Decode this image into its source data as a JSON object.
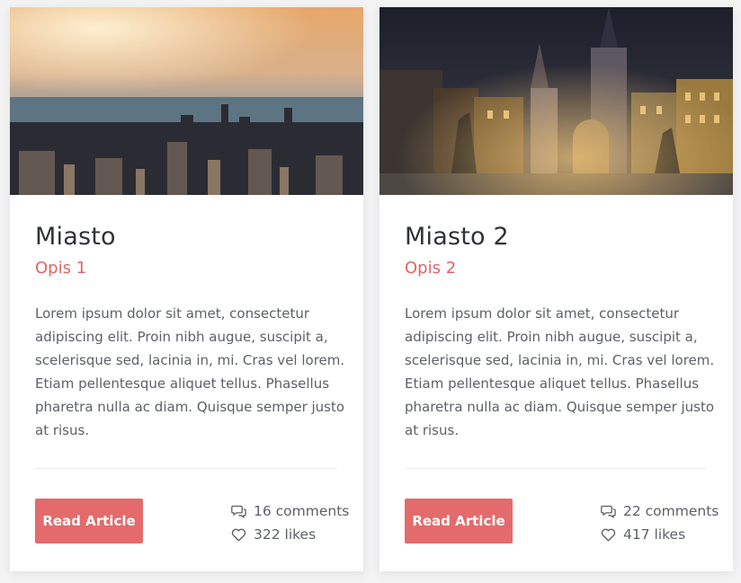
{
  "cards": [
    {
      "image_alt": "City skyline at sunset",
      "title": "Miasto",
      "subtitle": "Opis 1",
      "body": "Lorem ipsum dolor sit amet, consectetur adipiscing elit. Proin nibh augue, suscipit a, scelerisque sed, lacinia in, mi. Cras vel lorem. Etiam pellentesque aliquet tellus. Phasellus pharetra nulla ac diam. Quisque semper justo at risus.",
      "button_label": "Read Article",
      "comments": "16 comments",
      "likes": "322 likes"
    },
    {
      "image_alt": "Old town bridge tower at night",
      "title": "Miasto 2",
      "subtitle": "Opis 2",
      "body": "Lorem ipsum dolor sit amet, consectetur adipiscing elit. Proin nibh augue, suscipit a, scelerisque sed, lacinia in, mi. Cras vel lorem. Etiam pellentesque aliquet tellus. Phasellus pharetra nulla ac diam. Quisque semper justo at risus.",
      "button_label": "Read Article",
      "comments": "22 comments",
      "likes": "417 likes"
    }
  ],
  "colors": {
    "accent": "#e36b6b",
    "subtitle": "#e06565",
    "title": "#2f3237",
    "text": "#5d6167"
  },
  "icons": {
    "comments": "comments-icon",
    "likes": "heart-icon"
  }
}
